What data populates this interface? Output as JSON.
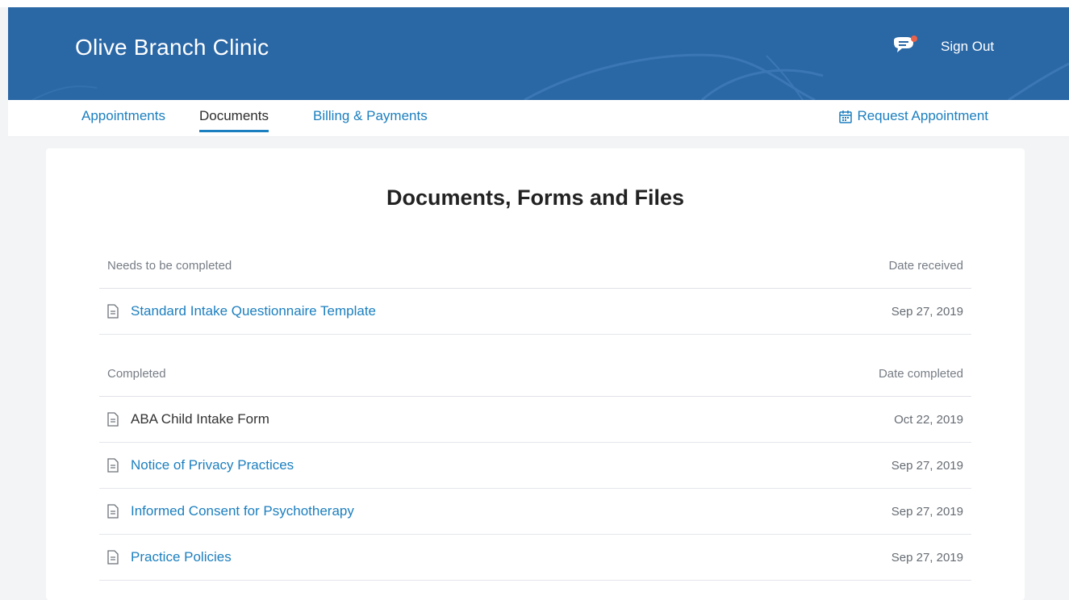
{
  "header": {
    "clinic_name": "Olive Branch Clinic",
    "sign_out_label": "Sign Out",
    "chat_icon": "chat-bubble-icon",
    "brand_color": "#2a67a5"
  },
  "nav": {
    "tabs": [
      {
        "label": "Appointments",
        "active": false
      },
      {
        "label": "Documents",
        "active": true
      },
      {
        "label": "Billing & Payments",
        "active": false
      }
    ],
    "request_appointment_label": "Request Appointment",
    "request_icon": "calendar-icon",
    "link_color": "#1c7fbf"
  },
  "main": {
    "title": "Documents, Forms and Files",
    "pending": {
      "header_left": "Needs to be completed",
      "header_right": "Date received",
      "items": [
        {
          "name": "Standard Intake Questionnaire Template",
          "date": "Sep 27, 2019",
          "link": true
        }
      ]
    },
    "completed": {
      "header_left": "Completed",
      "header_right": "Date completed",
      "items": [
        {
          "name": "ABA Child Intake Form",
          "date": "Oct 22, 2019",
          "link": false
        },
        {
          "name": "Notice of Privacy Practices",
          "date": "Sep 27, 2019",
          "link": true
        },
        {
          "name": "Informed Consent for Psychotherapy",
          "date": "Sep 27, 2019",
          "link": true
        },
        {
          "name": "Practice Policies",
          "date": "Sep 27, 2019",
          "link": true
        }
      ]
    }
  }
}
